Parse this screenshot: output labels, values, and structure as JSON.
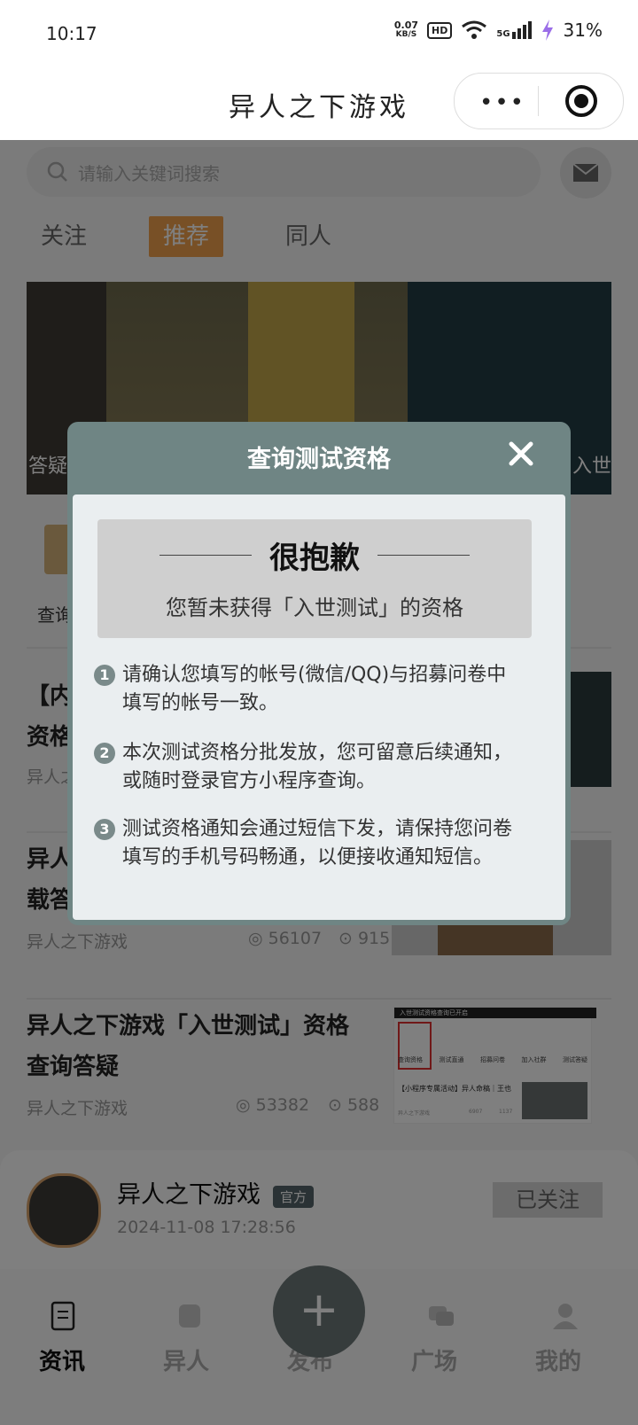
{
  "status_bar": {
    "time": "10:17",
    "net_speed": "0.07",
    "net_unit": "KB/S",
    "hd": "HD",
    "signal": "5G",
    "battery": "31%"
  },
  "header": {
    "title": "异人之下游戏",
    "more_icon": "•••"
  },
  "search": {
    "placeholder": "请输入关键词搜索"
  },
  "tabs": [
    {
      "label": "关注"
    },
    {
      "label": "推荐"
    },
    {
      "label": "同人"
    }
  ],
  "banner": {
    "left_caption": "答疑",
    "right_caption": "入世"
  },
  "quick_entry": {
    "label": "查询"
  },
  "articles": [
    {
      "title_line1": "【内",
      "title_line2": "资格",
      "source": "异人之"
    },
    {
      "title_line1": "异人",
      "title_line2": "载答疑",
      "source": "异人之下游戏",
      "views": "56107",
      "comments": "915"
    },
    {
      "title_line1": "异人之下游戏「入世测试」资格",
      "title_line2": "查询答疑",
      "source": "异人之下游戏",
      "views": "53382",
      "comments": "588"
    }
  ],
  "thumb3": {
    "top_text": "入世测试资格查询已开启",
    "items": [
      "查询资格",
      "测试直通",
      "招募问卷",
      "加入社群",
      "测试答疑"
    ],
    "bottom_title": "【小程序专属活动】异人命稿｜王也",
    "bottom_source": "异人之下游戏",
    "bottom_views": "6907",
    "bottom_comments": "1137"
  },
  "post": {
    "author": "异人之下游戏",
    "badge": "官方",
    "time": "2024-11-08 17:28:56",
    "follow": "已关注"
  },
  "tab_bar": [
    {
      "label": "资讯"
    },
    {
      "label": "异人"
    },
    {
      "label": "发布"
    },
    {
      "label": "广场"
    },
    {
      "label": "我的"
    }
  ],
  "fab": {
    "label": "+"
  },
  "modal": {
    "title": "查询测试资格",
    "heading": "很抱歉",
    "subheading": "您暂未获得「入世测试」的资格",
    "tips": [
      {
        "num": "1",
        "text": "请确认您填写的帐号(微信/QQ)与招募问卷中填写的帐号一致。"
      },
      {
        "num": "2",
        "text": "本次测试资格分批发放，您可留意后续通知，或随时登录官方小程序查询。"
      },
      {
        "num": "3",
        "text": "测试资格通知会通过短信下发，请保持您问卷填写的手机号码畅通，以便接收通知短信。"
      }
    ]
  }
}
